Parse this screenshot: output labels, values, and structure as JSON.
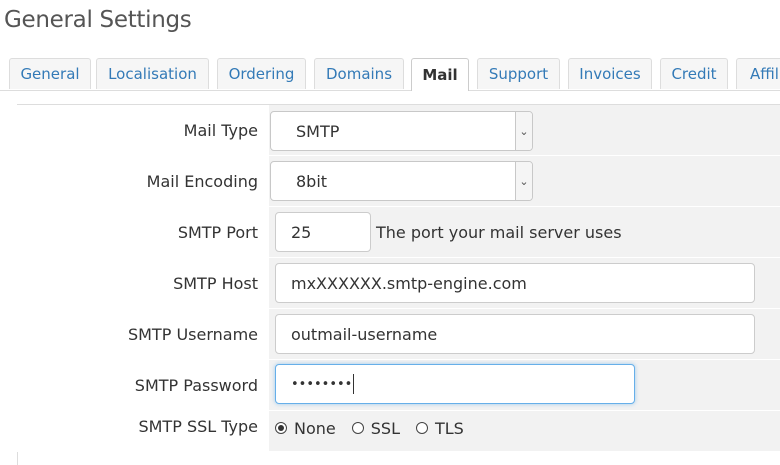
{
  "page": {
    "title": "General Settings"
  },
  "tabs": [
    {
      "label": "General"
    },
    {
      "label": "Localisation"
    },
    {
      "label": "Ordering"
    },
    {
      "label": "Domains"
    },
    {
      "label": "Mail",
      "active": true
    },
    {
      "label": "Support"
    },
    {
      "label": "Invoices"
    },
    {
      "label": "Credit"
    },
    {
      "label": "Affili"
    }
  ],
  "mail": {
    "mail_type": {
      "label": "Mail Type",
      "value": "SMTP"
    },
    "mail_encoding": {
      "label": "Mail Encoding",
      "value": "8bit"
    },
    "smtp_port": {
      "label": "SMTP Port",
      "value": "25",
      "help": "The port your mail server uses"
    },
    "smtp_host": {
      "label": "SMTP Host",
      "value": "mxXXXXXX.smtp-engine.com"
    },
    "smtp_username": {
      "label": "SMTP Username",
      "value": "outmail-username"
    },
    "smtp_password": {
      "label": "SMTP Password",
      "value": "••••••••"
    },
    "smtp_ssl_type": {
      "label": "SMTP SSL Type",
      "options": [
        "None",
        "SSL",
        "TLS"
      ],
      "selected": "None"
    }
  },
  "colors": {
    "link": "#337ab7",
    "focus": "#66afe9",
    "row_bg": "#f2f2f2"
  }
}
